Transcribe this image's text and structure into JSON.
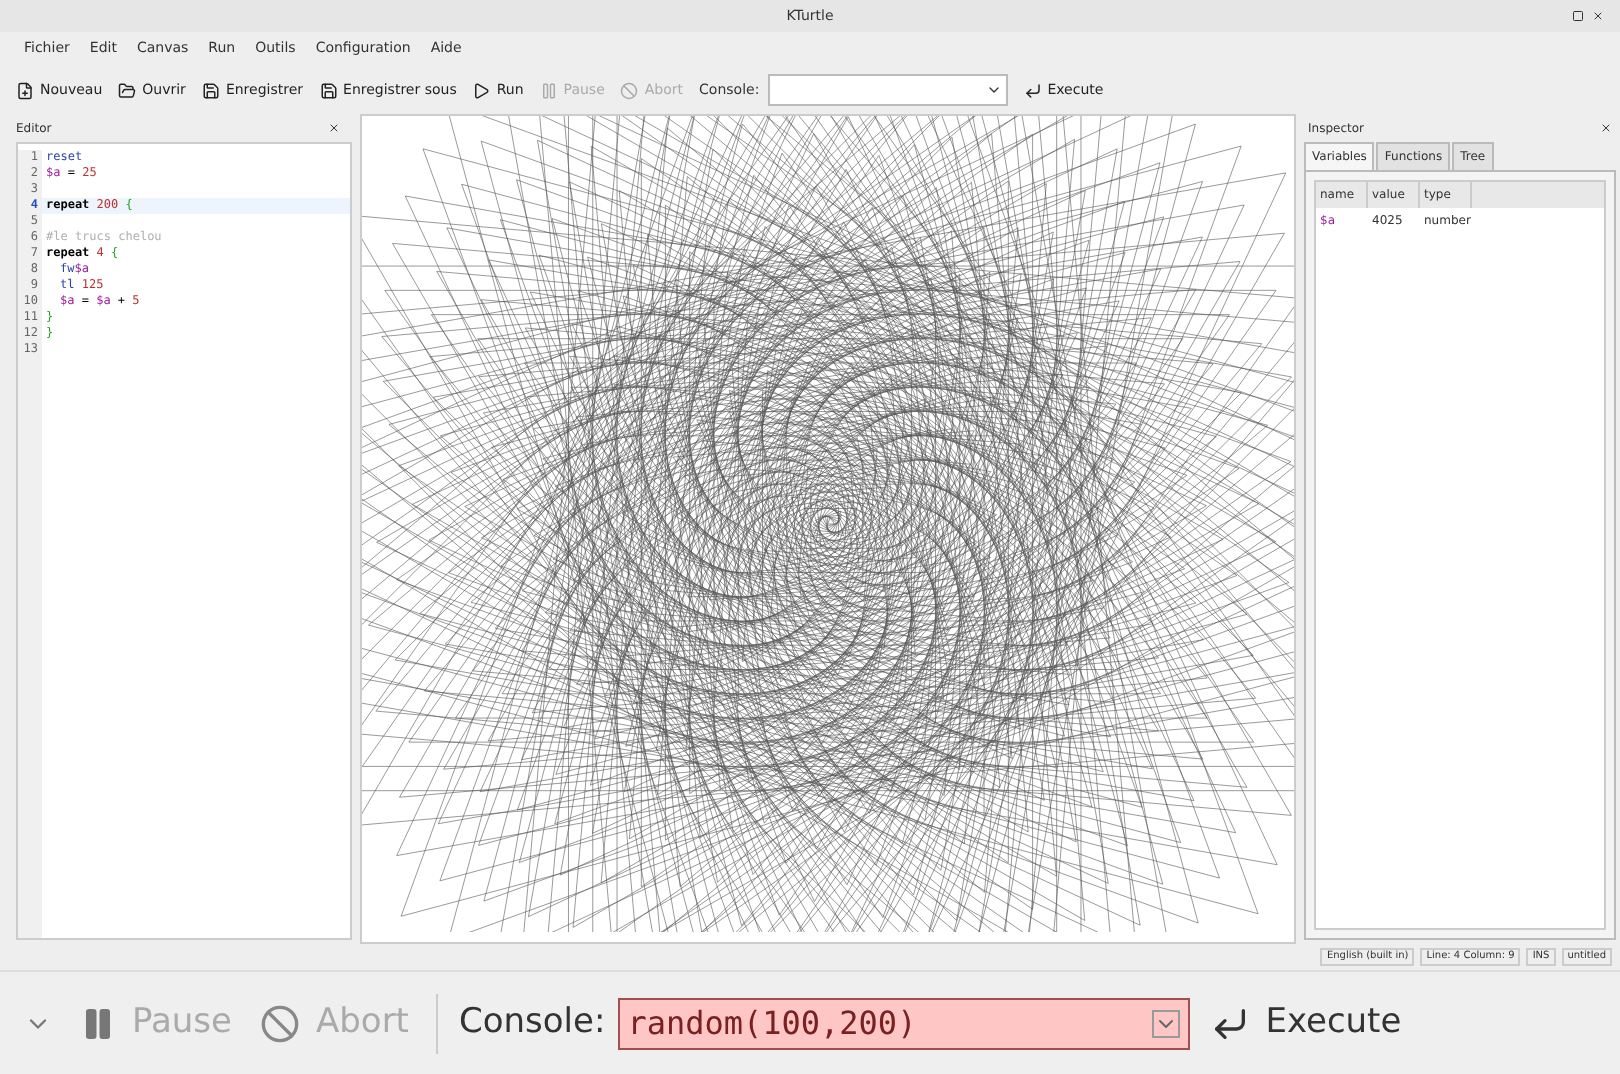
{
  "window": {
    "title": "KTurtle"
  },
  "menu": [
    "Fichier",
    "Edit",
    "Canvas",
    "Run",
    "Outils",
    "Configuration",
    "Aide"
  ],
  "toolbar": [
    {
      "kind": "button",
      "label": "Nouveau",
      "disabled": false
    },
    {
      "kind": "button",
      "label": "Ouvrir",
      "disabled": false
    },
    {
      "kind": "button",
      "label": "Enregistrer",
      "disabled": false
    },
    {
      "kind": "button",
      "label": "Enregistrer sous",
      "disabled": false
    },
    {
      "kind": "button",
      "label": "Run",
      "disabled": false
    },
    {
      "kind": "button",
      "label": "Pause",
      "disabled": true
    },
    {
      "kind": "button",
      "label": "Abort",
      "disabled": true
    },
    {
      "kind": "console",
      "label": "Console:"
    },
    {
      "kind": "button",
      "label": "Execute",
      "disabled": false
    }
  ],
  "editor": {
    "title": "Editor",
    "lines": [
      {
        "number": "1",
        "current": false,
        "indented": false,
        "tokens": [
          {
            "kind": "keyword",
            "text": "reset"
          }
        ]
      },
      {
        "number": "2",
        "current": false,
        "indented": false,
        "tokens": [
          {
            "kind": "variable",
            "text": "$a"
          },
          {
            "kind": "plain",
            "text": " = "
          },
          {
            "kind": "number",
            "text": "25"
          }
        ]
      },
      {
        "number": "3",
        "current": false
      },
      {
        "number": "4",
        "current": true,
        "indented": false,
        "tokens": [
          {
            "kind": "control",
            "text": "repeat"
          },
          {
            "kind": "number",
            "text": " 200"
          },
          {
            "kind": "brace",
            "text": " {"
          }
        ]
      },
      {
        "number": "5",
        "current": false
      },
      {
        "number": "6",
        "current": false,
        "indented": false,
        "tokens": [
          {
            "kind": "comment",
            "text": "#le trucs chelou"
          }
        ]
      },
      {
        "number": "7",
        "current": false,
        "indented": false,
        "tokens": [
          {
            "kind": "control",
            "text": "repeat"
          },
          {
            "kind": "number",
            "text": " 4"
          },
          {
            "kind": "brace",
            "text": " {"
          }
        ]
      },
      {
        "number": "8",
        "current": false,
        "indented": true,
        "tokens": [
          {
            "kind": "keyword",
            "text": "fw"
          },
          {
            "kind": "variable",
            "text": "$a"
          }
        ]
      },
      {
        "number": "9",
        "current": false,
        "indented": true,
        "tokens": [
          {
            "kind": "keyword",
            "text": "tl"
          },
          {
            "kind": "number",
            "text": " 125"
          }
        ]
      },
      {
        "number": "10",
        "current": false,
        "indented": true,
        "tokens": [
          {
            "kind": "variable",
            "text": "$a"
          },
          {
            "kind": "plain",
            "text": " = "
          },
          {
            "kind": "variable",
            "text": "$a"
          },
          {
            "kind": "plain",
            "text": " + "
          },
          {
            "kind": "number",
            "text": "5"
          }
        ]
      },
      {
        "number": "11",
        "current": false,
        "indented": false,
        "tokens": [
          {
            "kind": "brace",
            "text": "}"
          }
        ]
      },
      {
        "number": "12",
        "current": false,
        "indented": false,
        "tokens": [
          {
            "kind": "brace",
            "text": "}"
          }
        ]
      },
      {
        "number": "13",
        "current": false
      }
    ]
  },
  "inspector": {
    "title": "Inspector",
    "tabs": [
      {
        "label": "Variables",
        "selected": true
      },
      {
        "label": "Functions",
        "selected": false
      },
      {
        "label": "Tree",
        "selected": false
      }
    ],
    "columns": [
      "name",
      "value",
      "type"
    ],
    "rows": [
      [
        "$a",
        "4025",
        "number"
      ]
    ]
  },
  "status_bar": [
    "English (built in)",
    "Line: 4 Column: 9",
    "INS",
    "untitled"
  ],
  "console_bar": {
    "pause": "Pause",
    "abort": "Abort",
    "label": "Console:",
    "value": "random(100,200)",
    "error": true,
    "execute": "Execute"
  }
}
